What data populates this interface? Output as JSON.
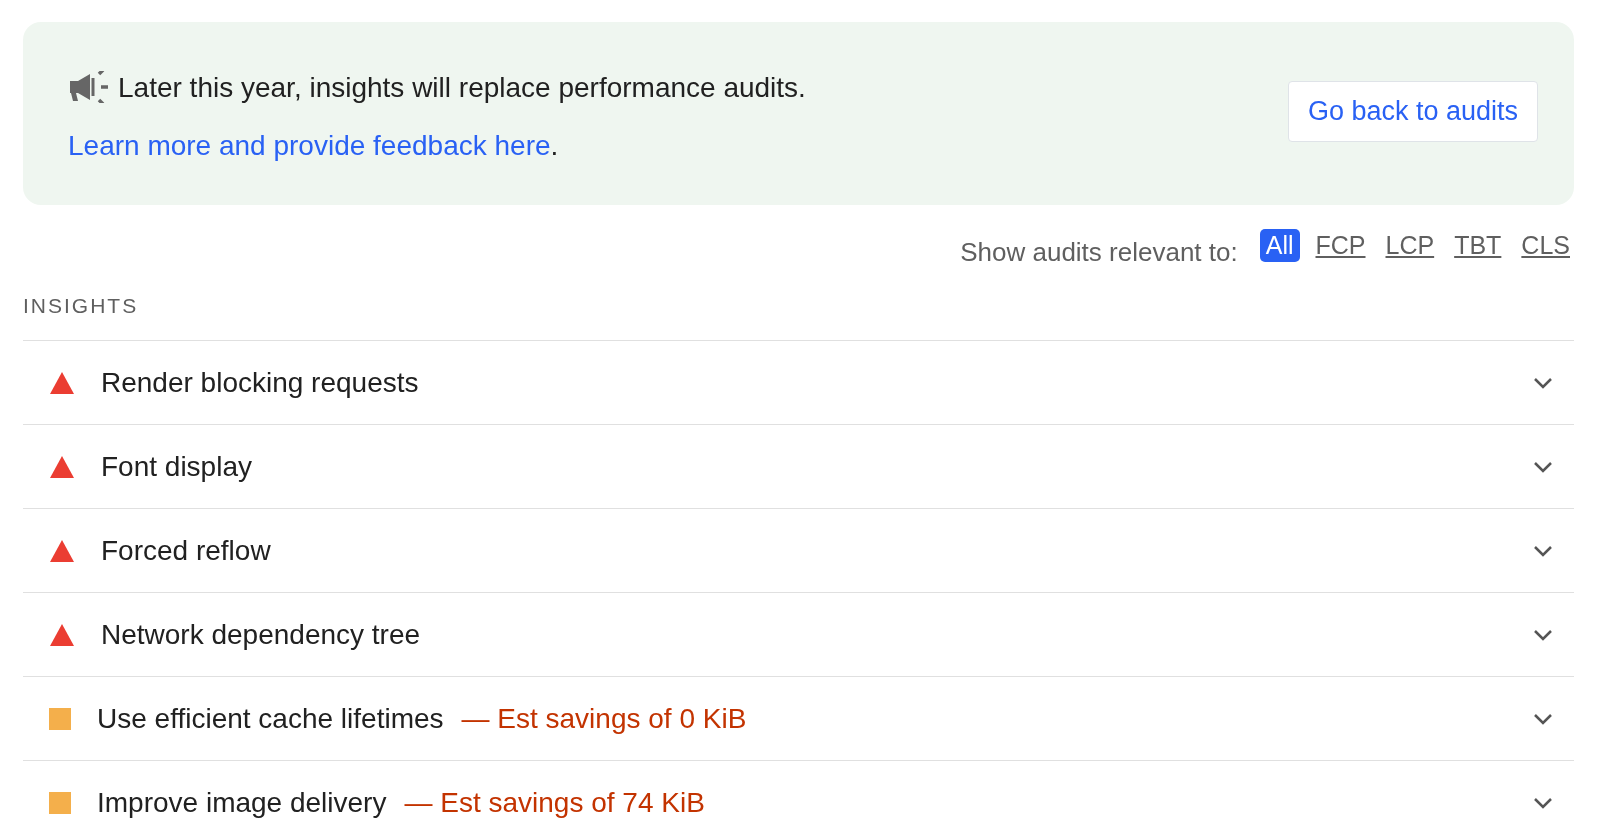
{
  "banner": {
    "message": "Later this year, insights will replace performance audits. ",
    "link": "Learn more and provide feedback here",
    "after": ".",
    "button": "Go back to audits"
  },
  "filter": {
    "label": "Show audits relevant to:",
    "options": [
      {
        "label": "All",
        "selected": true
      },
      {
        "label": "FCP",
        "selected": false
      },
      {
        "label": "LCP",
        "selected": false
      },
      {
        "label": "TBT",
        "selected": false
      },
      {
        "label": "CLS",
        "selected": false
      }
    ]
  },
  "section_title": "INSIGHTS",
  "audits": [
    {
      "title": "Render blocking requests",
      "kind": "fail"
    },
    {
      "title": "Font display",
      "kind": "fail"
    },
    {
      "title": "Forced reflow",
      "kind": "fail"
    },
    {
      "title": "Network dependency tree",
      "kind": "fail"
    },
    {
      "title": "Use efficient cache lifetimes",
      "kind": "average",
      "savings": "— Est savings of 0 KiB"
    },
    {
      "title": "Improve image delivery",
      "kind": "average",
      "savings": "— Est savings of 74 KiB"
    }
  ]
}
